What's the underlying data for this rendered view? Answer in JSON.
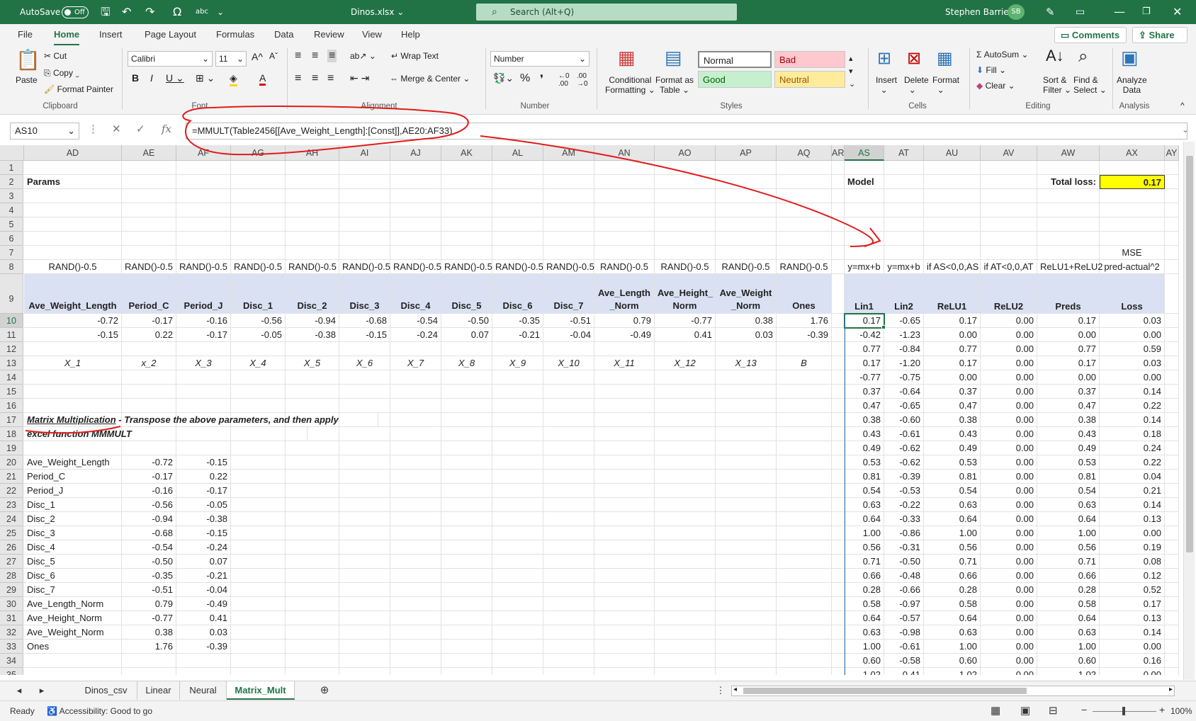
{
  "titlebar": {
    "autosave": "AutoSave",
    "toggle": "Off",
    "filename": "Dinos.xlsx",
    "search": "Search (Alt+Q)",
    "user": "Stephen Barrie",
    "initials": "SB"
  },
  "menu": {
    "tabs": [
      "File",
      "Home",
      "Insert",
      "Page Layout",
      "Formulas",
      "Data",
      "Review",
      "View",
      "Help"
    ],
    "comments": "Comments",
    "share": "Share"
  },
  "ribbon": {
    "clipboard": {
      "paste": "Paste",
      "cut": "Cut",
      "copy": "Copy",
      "format_painter": "Format Painter",
      "label": "Clipboard"
    },
    "font": {
      "name": "Calibri",
      "size": "11",
      "label": "Font"
    },
    "alignment": {
      "wrap": "Wrap Text",
      "merge": "Merge & Center",
      "label": "Alignment"
    },
    "number": {
      "format": "Number",
      "label": "Number"
    },
    "styles": {
      "conditional": "Conditional",
      "formatting": "Formatting",
      "format_as": "Format as",
      "table": "Table",
      "normal": "Normal",
      "bad": "Bad",
      "good": "Good",
      "neutral": "Neutral",
      "label": "Styles"
    },
    "cells": {
      "insert": "Insert",
      "delete": "Delete",
      "format": "Format",
      "label": "Cells"
    },
    "editing": {
      "autosum": "AutoSum",
      "fill": "Fill",
      "clear": "Clear",
      "sort": "Sort &",
      "filter": "Filter",
      "find": "Find &",
      "select": "Select",
      "label": "Editing"
    },
    "analysis": {
      "analyze": "Analyze",
      "data": "Data",
      "label": "Analysis"
    }
  },
  "formula_bar": {
    "name_box": "AS10",
    "formula": "=MMULT(Table2456[[Ave_Weight_Length]:[Const]],AE20:AF33)"
  },
  "columns": [
    "AD",
    "AE",
    "AF",
    "AG",
    "AH",
    "AI",
    "AJ",
    "AK",
    "AL",
    "AM",
    "AN",
    "AO",
    "AP",
    "AQ",
    "AR",
    "AS",
    "AT",
    "AU",
    "AV",
    "AW",
    "AX",
    "AY"
  ],
  "rows": [
    "1",
    "2",
    "3",
    "4",
    "5",
    "6",
    "7",
    "8",
    "9",
    "10",
    "11",
    "12",
    "13",
    "14",
    "15",
    "16",
    "17",
    "18",
    "19",
    "20",
    "21",
    "22",
    "23",
    "24",
    "25",
    "26",
    "27",
    "28",
    "29",
    "30",
    "31",
    "32",
    "33",
    "34",
    "35"
  ],
  "labels": {
    "params": "Params",
    "model": "Model",
    "total_loss": "Total loss:",
    "total_loss_value": "0.17",
    "mse": "MSE",
    "matrix_title": "Matrix Multiplication",
    "matrix_rest": " - Transpose the above parameters, and then apply",
    "matrix_line2": "excel function MMMULT"
  },
  "row8": [
    "RAND()-0.5",
    "RAND()-0.5",
    "RAND()-0.5",
    "RAND()-0.5",
    "RAND()-0.5",
    "RAND()-0.5",
    "RAND()-0.5",
    "RAND()-0.5",
    "RAND()-0.5",
    "RAND()-0.5",
    "RAND()-0.5",
    "RAND()-0.5",
    "RAND()-0.5",
    "RAND()-0.5"
  ],
  "row8_right": [
    "y=mx+b",
    "y=mx+b",
    "if AS<0,0,AS",
    "if AT<0,0,AT",
    "ReLU1+ReLU2",
    "pred-actual^2"
  ],
  "headers_left": [
    "Ave_Weight_Length",
    "Period_C",
    "Period_J",
    "Disc_1",
    "Disc_2",
    "Disc_3",
    "Disc_4",
    "Disc_5",
    "Disc_6",
    "Disc_7",
    "Ave_Length\n_Norm",
    "Ave_Height_\nNorm",
    "Ave_Weight\n_Norm",
    "Ones"
  ],
  "headers_right": [
    "Lin1",
    "Lin2",
    "ReLU1",
    "ReLU2",
    "Preds",
    "Loss"
  ],
  "row10": [
    "-0.72",
    "-0.17",
    "-0.16",
    "-0.56",
    "-0.94",
    "-0.68",
    "-0.54",
    "-0.50",
    "-0.35",
    "-0.51",
    "0.79",
    "-0.77",
    "0.38",
    "1.76"
  ],
  "row11": [
    "-0.15",
    "0.22",
    "-0.17",
    "-0.05",
    "-0.38",
    "-0.15",
    "-0.24",
    "0.07",
    "-0.21",
    "-0.04",
    "-0.49",
    "0.41",
    "0.03",
    "-0.39"
  ],
  "row13": [
    "X_1",
    "x_2",
    "X_3",
    "X_4",
    "X_5",
    "X_6",
    "X_7",
    "X_8",
    "X_9",
    "X_10",
    "X_11",
    "X_12",
    "X_13",
    "B"
  ],
  "matrix": [
    [
      "Ave_Weight_Length",
      "-0.72",
      "-0.15"
    ],
    [
      "Period_C",
      "-0.17",
      "0.22"
    ],
    [
      "Period_J",
      "-0.16",
      "-0.17"
    ],
    [
      "Disc_1",
      "-0.56",
      "-0.05"
    ],
    [
      "Disc_2",
      "-0.94",
      "-0.38"
    ],
    [
      "Disc_3",
      "-0.68",
      "-0.15"
    ],
    [
      "Disc_4",
      "-0.54",
      "-0.24"
    ],
    [
      "Disc_5",
      "-0.50",
      "0.07"
    ],
    [
      "Disc_6",
      "-0.35",
      "-0.21"
    ],
    [
      "Disc_7",
      "-0.51",
      "-0.04"
    ],
    [
      "Ave_Length_Norm",
      "0.79",
      "-0.49"
    ],
    [
      "Ave_Height_Norm",
      "-0.77",
      "0.41"
    ],
    [
      "Ave_Weight_Norm",
      "0.38",
      "0.03"
    ],
    [
      "Ones",
      "1.76",
      "-0.39"
    ]
  ],
  "model_rows": [
    [
      "0.17",
      "-0.65",
      "0.17",
      "0.00",
      "0.17",
      "0.03"
    ],
    [
      "-0.42",
      "-1.23",
      "0.00",
      "0.00",
      "0.00",
      "0.00"
    ],
    [
      "0.77",
      "-0.84",
      "0.77",
      "0.00",
      "0.77",
      "0.59"
    ],
    [
      "0.17",
      "-1.20",
      "0.17",
      "0.00",
      "0.17",
      "0.03"
    ],
    [
      "-0.77",
      "-0.75",
      "0.00",
      "0.00",
      "0.00",
      "0.00"
    ],
    [
      "0.37",
      "-0.64",
      "0.37",
      "0.00",
      "0.37",
      "0.14"
    ],
    [
      "0.47",
      "-0.65",
      "0.47",
      "0.00",
      "0.47",
      "0.22"
    ],
    [
      "0.38",
      "-0.60",
      "0.38",
      "0.00",
      "0.38",
      "0.14"
    ],
    [
      "0.43",
      "-0.61",
      "0.43",
      "0.00",
      "0.43",
      "0.18"
    ],
    [
      "0.49",
      "-0.62",
      "0.49",
      "0.00",
      "0.49",
      "0.24"
    ],
    [
      "0.53",
      "-0.62",
      "0.53",
      "0.00",
      "0.53",
      "0.22"
    ],
    [
      "0.81",
      "-0.39",
      "0.81",
      "0.00",
      "0.81",
      "0.04"
    ],
    [
      "0.54",
      "-0.53",
      "0.54",
      "0.00",
      "0.54",
      "0.21"
    ],
    [
      "0.63",
      "-0.22",
      "0.63",
      "0.00",
      "0.63",
      "0.14"
    ],
    [
      "0.64",
      "-0.33",
      "0.64",
      "0.00",
      "0.64",
      "0.13"
    ],
    [
      "1.00",
      "-0.86",
      "1.00",
      "0.00",
      "1.00",
      "0.00"
    ],
    [
      "0.56",
      "-0.31",
      "0.56",
      "0.00",
      "0.56",
      "0.19"
    ],
    [
      "0.71",
      "-0.50",
      "0.71",
      "0.00",
      "0.71",
      "0.08"
    ],
    [
      "0.66",
      "-0.48",
      "0.66",
      "0.00",
      "0.66",
      "0.12"
    ],
    [
      "0.28",
      "-0.66",
      "0.28",
      "0.00",
      "0.28",
      "0.52"
    ],
    [
      "0.58",
      "-0.97",
      "0.58",
      "0.00",
      "0.58",
      "0.17"
    ],
    [
      "0.64",
      "-0.57",
      "0.64",
      "0.00",
      "0.64",
      "0.13"
    ],
    [
      "0.63",
      "-0.98",
      "0.63",
      "0.00",
      "0.63",
      "0.14"
    ],
    [
      "1.00",
      "-0.61",
      "1.00",
      "0.00",
      "1.00",
      "0.00"
    ],
    [
      "0.60",
      "-0.58",
      "0.60",
      "0.00",
      "0.60",
      "0.16"
    ],
    [
      "1.02",
      "-0.41",
      "1.02",
      "0.00",
      "1.02",
      "0.00"
    ]
  ],
  "sheet_tabs": [
    "Dinos_csv",
    "Linear",
    "Neural",
    "Matrix_Mult"
  ],
  "status": {
    "ready": "Ready",
    "accessibility": "Accessibility: Good to go",
    "zoom": "100%"
  },
  "colors": {
    "accent": "#217346",
    "header_band": "#d9e1f2",
    "total_loss_bg": "#ffff00",
    "annotation": "#e21b1b"
  }
}
